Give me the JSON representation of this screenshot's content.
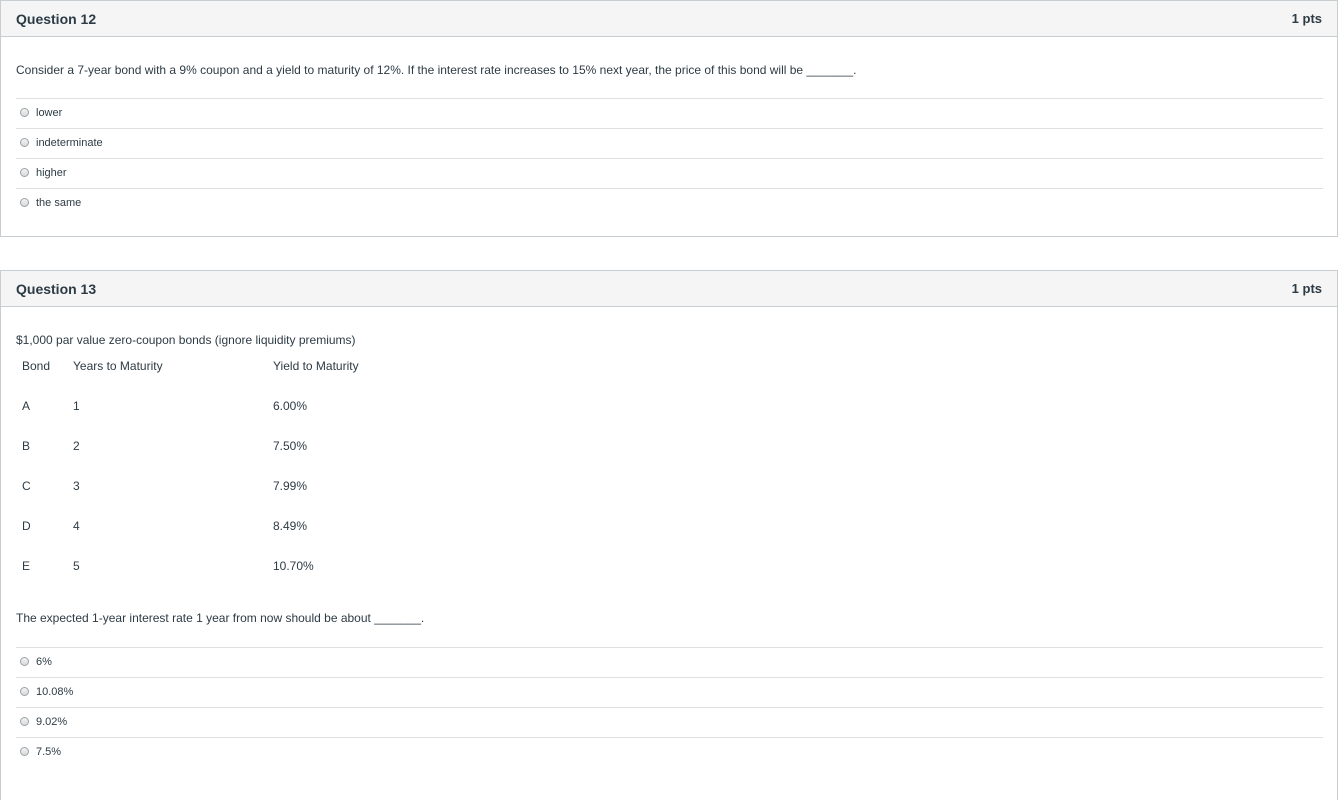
{
  "questions": [
    {
      "title": "Question 12",
      "points": "1 pts",
      "prompt": "Consider a 7-year bond with a 9% coupon and a yield to maturity of 12%. If the interest rate increases to 15% next year, the price of this bond will be _______.",
      "answers": [
        "lower",
        "indeterminate",
        "higher",
        "the same"
      ]
    },
    {
      "title": "Question 13",
      "points": "1 pts",
      "intro": "$1,000 par value zero-coupon bonds (ignore liquidity premiums)",
      "table": {
        "headers": [
          "Bond",
          "Years to Maturity",
          "Yield to Maturity"
        ],
        "rows": [
          [
            "A",
            "1",
            "6.00%"
          ],
          [
            "B",
            "2",
            "7.50%"
          ],
          [
            "C",
            "3",
            "7.99%"
          ],
          [
            "D",
            "4",
            "8.49%"
          ],
          [
            "E",
            "5",
            "10.70%"
          ]
        ]
      },
      "prompt": "The expected 1-year interest rate 1 year from now should be about _______.",
      "answers": [
        "6%",
        "10.08%",
        "9.02%",
        "7.5%"
      ]
    }
  ]
}
